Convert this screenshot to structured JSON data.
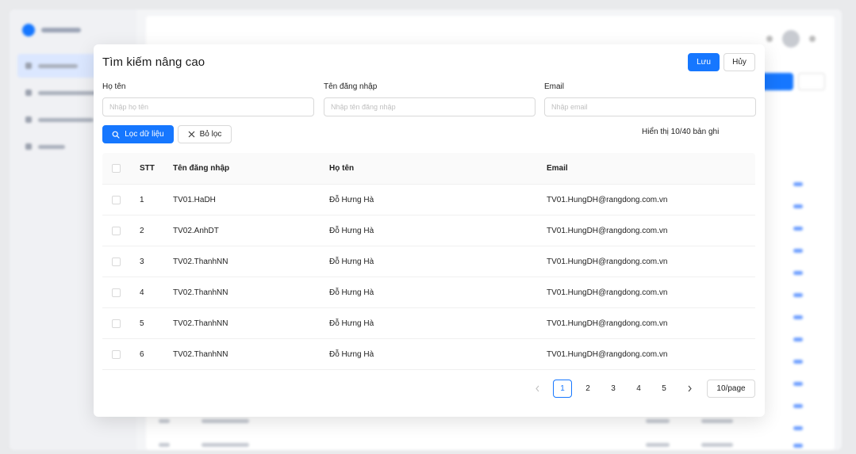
{
  "modal": {
    "title": "Tìm kiếm nâng cao",
    "save_label": "Lưu",
    "cancel_label": "Hủy"
  },
  "filters": {
    "fullname": {
      "label": "Họ tên",
      "placeholder": "Nhập họ tên",
      "value": ""
    },
    "username": {
      "label": "Tên đăng nhập",
      "placeholder": "Nhập tên đăng nhập",
      "value": ""
    },
    "email": {
      "label": "Email",
      "placeholder": "Nhập email",
      "value": ""
    },
    "filter_label": "Lọc dữ liệu",
    "clear_label": "Bỏ lọc"
  },
  "record_info": "Hiển thị 10/40 bản ghi",
  "table": {
    "headers": {
      "stt": "STT",
      "username": "Tên đăng nhập",
      "fullname": "Họ tên",
      "email": "Email"
    },
    "rows": [
      {
        "stt": "1",
        "username": "TV01.HaDH",
        "fullname": "Đỗ Hưng Hà",
        "email": "TV01.HungDH@rangdong.com.vn"
      },
      {
        "stt": "2",
        "username": "TV02.AnhDT",
        "fullname": "Đỗ Hưng Hà",
        "email": "TV01.HungDH@rangdong.com.vn"
      },
      {
        "stt": "3",
        "username": "TV02.ThanhNN",
        "fullname": "Đỗ Hưng Hà",
        "email": "TV01.HungDH@rangdong.com.vn"
      },
      {
        "stt": "4",
        "username": "TV02.ThanhNN",
        "fullname": "Đỗ Hưng Hà",
        "email": "TV01.HungDH@rangdong.com.vn"
      },
      {
        "stt": "5",
        "username": "TV02.ThanhNN",
        "fullname": "Đỗ Hưng Hà",
        "email": "TV01.HungDH@rangdong.com.vn"
      },
      {
        "stt": "6",
        "username": "TV02.ThanhNN",
        "fullname": "Đỗ Hưng Hà",
        "email": "TV01.HungDH@rangdong.com.vn"
      }
    ]
  },
  "pagination": {
    "pages": [
      "1",
      "2",
      "3",
      "4",
      "5"
    ],
    "current_page": "1",
    "page_size": "10/page"
  },
  "colors": {
    "primary": "#1677ff",
    "border": "#d9d9d9"
  },
  "icons": {
    "filter_button": "search-icon",
    "clear_button": "close-icon",
    "prev": "chevron-left-icon",
    "next": "chevron-right-icon"
  }
}
